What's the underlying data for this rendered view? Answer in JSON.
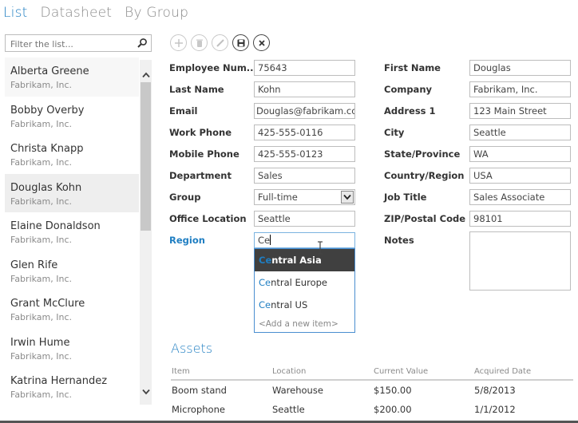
{
  "tabs": [
    {
      "label": "List",
      "active": true
    },
    {
      "label": "Datasheet",
      "active": false
    },
    {
      "label": "By Group",
      "active": false
    }
  ],
  "filter": {
    "placeholder": "Filter the list...",
    "value": "",
    "icon": "search-icon"
  },
  "toolbar": [
    {
      "name": "add",
      "icon": "plus-icon",
      "enabled": false
    },
    {
      "name": "delete",
      "icon": "trash-icon",
      "enabled": false
    },
    {
      "name": "edit",
      "icon": "pencil-icon",
      "enabled": false
    },
    {
      "name": "save",
      "icon": "save-icon",
      "enabled": true
    },
    {
      "name": "cancel",
      "icon": "close-icon",
      "enabled": true
    }
  ],
  "list": {
    "items": [
      {
        "name": "Alberta Greene",
        "company": "Fabrikam, Inc."
      },
      {
        "name": "Bobby Overby",
        "company": "Fabrikam, Inc."
      },
      {
        "name": "Christa Knapp",
        "company": "Fabrikam, Inc."
      },
      {
        "name": "Douglas Kohn",
        "company": "Fabrikam, Inc."
      },
      {
        "name": "Elaine Donaldson",
        "company": "Fabrikam, Inc."
      },
      {
        "name": "Glen Rife",
        "company": "Fabrikam, Inc."
      },
      {
        "name": "Grant McClure",
        "company": "Fabrikam, Inc."
      },
      {
        "name": "Irwin Hume",
        "company": "Fabrikam, Inc."
      },
      {
        "name": "Katrina Hernandez",
        "company": "Fabrikam, Inc."
      }
    ],
    "selected_index": 3
  },
  "form": {
    "left": [
      {
        "label": "Employee Num...",
        "value": "75643"
      },
      {
        "label": "Last Name",
        "value": "Kohn"
      },
      {
        "label": "Email",
        "value": "Douglas@fabrikam.com"
      },
      {
        "label": "Work Phone",
        "value": "425-555-0116"
      },
      {
        "label": "Mobile Phone",
        "value": "425-555-0123"
      },
      {
        "label": "Department",
        "value": "Sales"
      },
      {
        "label": "Group",
        "value": "Full-time"
      },
      {
        "label": "Office Location",
        "value": "Seattle"
      },
      {
        "label": "Region",
        "value": "Ce"
      }
    ],
    "right": [
      {
        "label": "First Name",
        "value": "Douglas"
      },
      {
        "label": "Company",
        "value": "Fabrikam, Inc."
      },
      {
        "label": "Address 1",
        "value": "123 Main Street"
      },
      {
        "label": "City",
        "value": "Seattle"
      },
      {
        "label": "State/Province",
        "value": "WA"
      },
      {
        "label": "Country/Region",
        "value": "USA"
      },
      {
        "label": "Job Title",
        "value": "Sales Associate"
      },
      {
        "label": "ZIP/Postal Code",
        "value": "98101"
      },
      {
        "label": "Notes",
        "value": ""
      }
    ]
  },
  "region_dropdown": {
    "match": "Ce",
    "options": [
      {
        "match": "Ce",
        "rest": "ntral Asia",
        "active": true
      },
      {
        "match": "Ce",
        "rest": "ntral Europe",
        "active": false
      },
      {
        "match": "Ce",
        "rest": "ntral US",
        "active": false
      }
    ],
    "add_new": "<Add a new item>"
  },
  "assets": {
    "title": "Assets",
    "columns": [
      "Item",
      "Location",
      "Current Value",
      "Acquired Date"
    ],
    "rows": [
      [
        "Boom stand",
        "Warehouse",
        "$150.00",
        "5/8/2013"
      ],
      [
        "Microphone",
        "Seattle",
        "$200.00",
        "1/1/2012"
      ]
    ]
  },
  "colors": {
    "accent": "#1f7ec2",
    "dropdown_active": "#404040"
  }
}
